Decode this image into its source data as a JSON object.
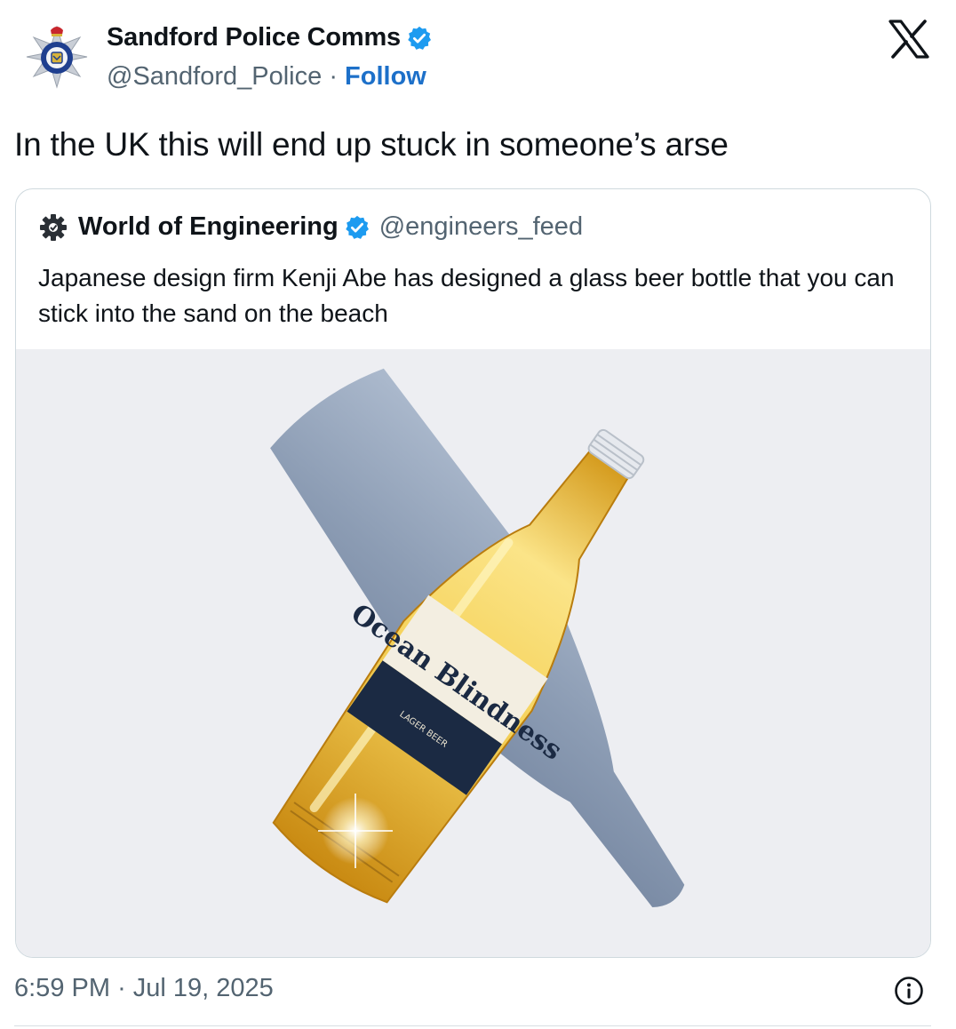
{
  "author": {
    "name": "Sandford Police Comms",
    "handle": "@Sandford_Police",
    "separator": "·",
    "follow_label": "Follow",
    "verified_color": "#1d9bf0",
    "avatar_icon": "police-crest-icon"
  },
  "platform_icon": "x-logo-icon",
  "tweet": {
    "text": "In the UK this will end up stuck in someone’s arse"
  },
  "quoted_tweet": {
    "author_name": "World of Engineering",
    "author_handle": "@engineers_feed",
    "avatar_icon": "gear-icon",
    "text": "Japanese design firm Kenji Abe has designed a glass beer bottle that you can stick into the sand on the beach",
    "media": {
      "description_icon": "beer-bottle-image",
      "label_title": "Ocean Blindness",
      "label_subtitle": "LAGER BEER"
    }
  },
  "footer": {
    "time": "6:59 PM",
    "separator": "·",
    "date": "Jul 19, 2025",
    "info_icon": "info-icon"
  }
}
